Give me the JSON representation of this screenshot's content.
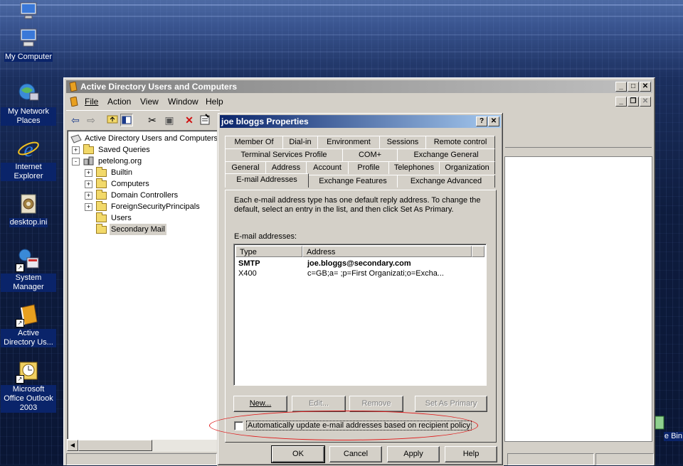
{
  "desktop": {
    "icons": [
      {
        "name": "my-computer",
        "label": "My Computer",
        "selected": true
      },
      {
        "name": "my-network-places",
        "label": "My Network Places",
        "selected": true
      },
      {
        "name": "internet-explorer",
        "label": "Internet Explorer",
        "selected": true
      },
      {
        "name": "desktop-ini",
        "label": "desktop.ini",
        "selected": true
      },
      {
        "name": "system-manager",
        "label": "System Manager",
        "selected": true
      },
      {
        "name": "active-directory",
        "label": "Active Directory Us...",
        "selected": true
      },
      {
        "name": "outlook-2003",
        "label": "Microsoft Office Outlook 2003",
        "selected": true
      },
      {
        "name": "recycle-bin",
        "label": "e Bin",
        "selected": true
      }
    ]
  },
  "main_window": {
    "title": "Active Directory Users and Computers",
    "menu": [
      "File",
      "Action",
      "View",
      "Window",
      "Help"
    ],
    "tree": {
      "root": "Active Directory Users and Computers",
      "items": [
        {
          "label": "Saved Queries",
          "level": 1,
          "expander": "+"
        },
        {
          "label": "petelong.org",
          "level": 1,
          "expander": "-"
        },
        {
          "label": "Builtin",
          "level": 2,
          "expander": "+"
        },
        {
          "label": "Computers",
          "level": 2,
          "expander": "+"
        },
        {
          "label": "Domain Controllers",
          "level": 2,
          "expander": "+"
        },
        {
          "label": "ForeignSecurityPrincipals",
          "level": 2,
          "expander": "+"
        },
        {
          "label": "Users",
          "level": 2,
          "expander": ""
        },
        {
          "label": "Secondary Mail",
          "level": 2,
          "expander": "",
          "selected": true
        }
      ]
    }
  },
  "dialog": {
    "title": "joe bloggs Properties",
    "tabs_row1": [
      "Member Of",
      "Dial-in",
      "Environment",
      "Sessions",
      "Remote control"
    ],
    "tabs_row2": [
      "Terminal Services Profile",
      "COM+",
      "Exchange General"
    ],
    "tabs_row3": [
      "General",
      "Address",
      "Account",
      "Profile",
      "Telephones",
      "Organization"
    ],
    "tabs_row4": [
      "E-mail Addresses",
      "Exchange Features",
      "Exchange Advanced"
    ],
    "active_tab": "E-mail Addresses",
    "description": "Each e-mail address type has one default reply address. To change the default, select an entry in the list, and then click Set As Primary.",
    "list_label": "E-mail addresses:",
    "columns": [
      "Type",
      "Address"
    ],
    "rows": [
      {
        "type": "SMTP",
        "address": "joe.bloggs@secondary.com"
      },
      {
        "type": "X400",
        "address": "c=GB;a= ;p=First Organizati;o=Excha..."
      }
    ],
    "buttons": {
      "new": "New...",
      "edit": "Edit...",
      "remove": "Remove",
      "set_primary": "Set As Primary"
    },
    "checkbox_label": "Automatically update e-mail addresses based on recipient policy",
    "checkbox_checked": false,
    "footer": {
      "ok": "OK",
      "cancel": "Cancel",
      "apply": "Apply",
      "help": "Help"
    }
  },
  "annotation_color": "#e01818"
}
